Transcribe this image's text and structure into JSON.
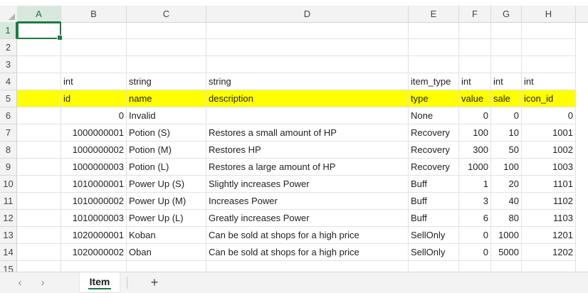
{
  "columns": [
    "A",
    "B",
    "C",
    "D",
    "E",
    "F",
    "G",
    "H"
  ],
  "rows": [
    {
      "num": "1",
      "cells": [
        "",
        "",
        "",
        "",
        "",
        "",
        "",
        ""
      ]
    },
    {
      "num": "2",
      "cells": [
        "",
        "",
        "",
        "",
        "",
        "",
        "",
        ""
      ]
    },
    {
      "num": "3",
      "cells": [
        "",
        "",
        "",
        "",
        "",
        "",
        "",
        ""
      ]
    },
    {
      "num": "4",
      "cells": [
        "",
        "int",
        "string",
        "string",
        "item_type",
        "int",
        "int",
        "int"
      ]
    },
    {
      "num": "5",
      "cells": [
        "",
        "id",
        "name",
        "description",
        "type",
        "value",
        "sale",
        "icon_id"
      ]
    },
    {
      "num": "6",
      "cells": [
        "",
        "0",
        "Invalid",
        "",
        "None",
        "0",
        "0",
        "0"
      ]
    },
    {
      "num": "7",
      "cells": [
        "",
        "1000000001",
        "Potion (S)",
        "Restores a small amount of HP",
        "Recovery",
        "100",
        "10",
        "1001"
      ]
    },
    {
      "num": "8",
      "cells": [
        "",
        "1000000002",
        "Potion (M)",
        "Restores HP",
        "Recovery",
        "300",
        "50",
        "1002"
      ]
    },
    {
      "num": "9",
      "cells": [
        "",
        "1000000003",
        "Potion (L)",
        "Restores a large amount of HP",
        "Recovery",
        "1000",
        "100",
        "1003"
      ]
    },
    {
      "num": "10",
      "cells": [
        "",
        "1010000001",
        "Power Up (S)",
        "Slightly increases Power",
        "Buff",
        "1",
        "20",
        "1101"
      ]
    },
    {
      "num": "11",
      "cells": [
        "",
        "1010000002",
        "Power Up (M)",
        "Increases Power",
        "Buff",
        "3",
        "40",
        "1102"
      ]
    },
    {
      "num": "12",
      "cells": [
        "",
        "1010000003",
        "Power Up (L)",
        "Greatly increases Power",
        "Buff",
        "6",
        "80",
        "1103"
      ]
    },
    {
      "num": "13",
      "cells": [
        "",
        "1020000001",
        "Koban",
        "Can be sold at shops for a high price",
        "SellOnly",
        "0",
        "1000",
        "1201"
      ]
    },
    {
      "num": "14",
      "cells": [
        "",
        "1020000002",
        "Oban",
        "Can be sold at shops for a high price",
        "SellOnly",
        "0",
        "5000",
        "1202"
      ]
    },
    {
      "num": "15",
      "cells": [
        "",
        "",
        "",
        "",
        "",
        "",
        "",
        ""
      ]
    }
  ],
  "highlight_color": "#ffff00",
  "accent_color": "#1e7a43",
  "sheet_tabs": [
    {
      "label": "Item"
    }
  ],
  "icons": {
    "prev": "chevron-left-icon",
    "next": "chevron-right-icon",
    "add": "plus-icon"
  },
  "nav": {
    "prev_glyph": "‹",
    "next_glyph": "›",
    "add_glyph": "+"
  }
}
